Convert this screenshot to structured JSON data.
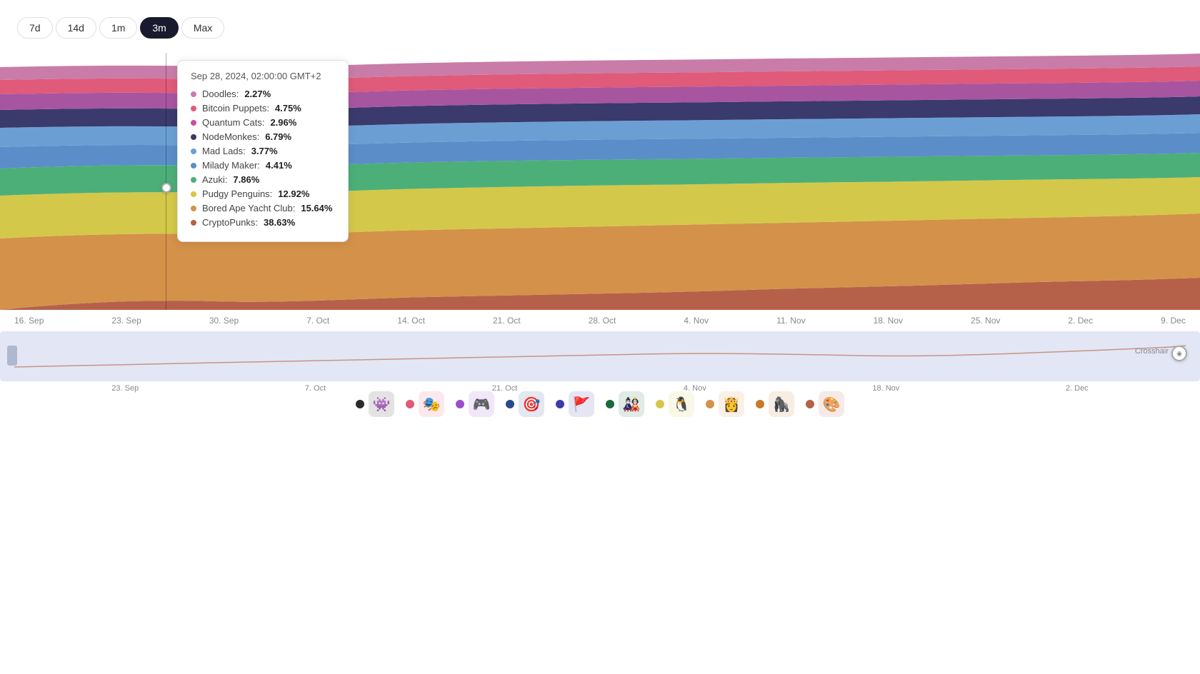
{
  "timeFilters": {
    "options": [
      "7d",
      "14d",
      "1m",
      "3m",
      "Max"
    ],
    "active": "3m"
  },
  "tooltip": {
    "date": "Sep 28, 2024, 02:00:00 GMT+2",
    "items": [
      {
        "name": "Doodles",
        "value": "2.27%",
        "color": "#c97ca8"
      },
      {
        "name": "Bitcoin Puppets",
        "value": "4.75%",
        "color": "#e05a7a"
      },
      {
        "name": "Quantum Cats",
        "value": "2.96%",
        "color": "#c94fa0"
      },
      {
        "name": "NodeMonkes",
        "value": "6.79%",
        "color": "#3a3a5c"
      },
      {
        "name": "Mad Lads",
        "value": "3.77%",
        "color": "#6b9fd4"
      },
      {
        "name": "Milady Maker",
        "value": "4.41%",
        "color": "#5b8dc9"
      },
      {
        "name": "Azuki",
        "value": "7.86%",
        "color": "#4caf78"
      },
      {
        "name": "Pudgy Penguins",
        "value": "12.92%",
        "color": "#d4c84a"
      },
      {
        "name": "Bored Ape Yacht Club",
        "value": "15.64%",
        "color": "#d4914a"
      },
      {
        "name": "CryptoPunks",
        "value": "38.63%",
        "color": "#b5614a"
      }
    ]
  },
  "xAxisLabels": [
    "16. Sep",
    "23. Sep",
    "30. Sep",
    "7. Oct",
    "14. Oct",
    "21. Oct",
    "28. Oct",
    "4. Nov",
    "11. Nov",
    "18. Nov",
    "25. Nov",
    "2. Dec",
    "9. Dec"
  ],
  "miniXAxisLabels": [
    "23. Sep",
    "7. Oct",
    "21. Oct",
    "4. Nov",
    "18. Nov",
    "2. Dec"
  ],
  "legends": [
    {
      "name": "CryptoPunks",
      "color": "#2a2a2a",
      "emoji": "👾"
    },
    {
      "name": "Bitcoin Puppets",
      "color": "#e05a7a",
      "emoji": "🎭"
    },
    {
      "name": "Quantum Cats",
      "color": "#9b4dca",
      "emoji": "🎮"
    },
    {
      "name": "NodeMonkes",
      "color": "#2a4a8a",
      "emoji": "🎯"
    },
    {
      "name": "Mad Lads",
      "color": "#3a3aaa",
      "emoji": "🚩"
    },
    {
      "name": "Azuki",
      "color": "#1a6a3a",
      "emoji": "🎎"
    },
    {
      "name": "Pudgy Penguins",
      "color": "#d4c84a",
      "emoji": "🐧"
    },
    {
      "name": "Milady Maker",
      "color": "#d4914a",
      "emoji": "👸"
    },
    {
      "name": "Bored Ape Yacht Club",
      "color": "#c87a2a",
      "emoji": "🦍"
    },
    {
      "name": "Doodles",
      "color": "#b5614a",
      "emoji": "🎨"
    }
  ]
}
